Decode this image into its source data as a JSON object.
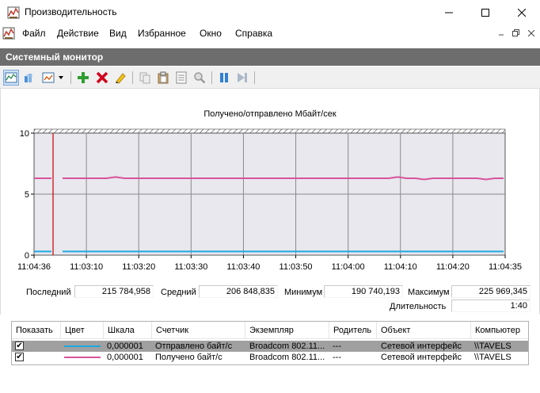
{
  "window": {
    "title": "Производительность",
    "controls": [
      "minimize-icon",
      "maximize-icon",
      "close-icon"
    ]
  },
  "menu": {
    "items": [
      "Файл",
      "Действие",
      "Вид",
      "Избранное",
      "Окно",
      "Справка"
    ]
  },
  "panel": {
    "title": "Системный монитор"
  },
  "toolbar": {
    "icons": [
      "view-graph-icon",
      "view-histogram-icon",
      "view-report-icon",
      "dropdown-arrow-icon",
      "add-counter-icon",
      "delete-counter-icon",
      "highlight-icon",
      "copy-icon",
      "paste-icon",
      "properties-icon",
      "zoom-icon",
      "pause-icon",
      "next-icon"
    ]
  },
  "chart_data": {
    "type": "line",
    "title": "Получено/отправлено Мбайт/сек",
    "ylim": [
      0,
      10
    ],
    "yticks": [
      "10",
      "5",
      "0"
    ],
    "xticks": [
      "11:04:36",
      "11:03:10",
      "11:03:20",
      "11:03:30",
      "11:03:40",
      "11:03:50",
      "11:04:00",
      "11:04:10",
      "11:04:20",
      "11:04:35"
    ],
    "current_time_marker": "11:04:36",
    "colors": {
      "received": "#d9539b",
      "sent": "#1fa7e1",
      "marker": "#cc0000",
      "plot_bg": "#e8e8ee",
      "grid": "#8a8a8a"
    },
    "series": [
      {
        "values": [
          6.3,
          6.3,
          6.3,
          6.3,
          6.3,
          6.3,
          6.4,
          6.3,
          6.3,
          6.3,
          6.3,
          6.3,
          6.3,
          6.3,
          6.3,
          6.3,
          6.3,
          6.3,
          6.3,
          6.3,
          6.3,
          6.3,
          6.3,
          6.3,
          6.3,
          6.3,
          6.3,
          6.3,
          6.3,
          6.3,
          6.3,
          6.3,
          6.3,
          6.3,
          6.3,
          6.3,
          6.3,
          6.3,
          6.4,
          6.3,
          6.3,
          6.2,
          6.3,
          6.3,
          6.3,
          6.3,
          6.3,
          6.3,
          6.2,
          6.3,
          6.3
        ],
        "color": "#d9539b"
      },
      {
        "values": [
          0.3,
          0.3,
          0.3,
          0.3,
          0.3,
          0.3,
          0.3,
          0.3,
          0.3,
          0.3,
          0.3,
          0.3,
          0.3,
          0.3,
          0.3,
          0.3,
          0.3,
          0.3,
          0.3,
          0.3,
          0.3,
          0.3,
          0.3,
          0.3,
          0.3,
          0.3,
          0.3,
          0.3,
          0.3,
          0.3,
          0.3,
          0.3,
          0.3,
          0.3,
          0.3,
          0.3,
          0.3,
          0.3,
          0.3,
          0.3,
          0.3,
          0.3,
          0.3,
          0.3,
          0.3,
          0.3,
          0.3,
          0.3,
          0.3,
          0.3,
          0.3
        ],
        "color": "#1fa7e1"
      }
    ]
  },
  "stats": {
    "last_label": "Последний",
    "last_value": "215 784,958",
    "avg_label": "Средний",
    "avg_value": "206 848,835",
    "min_label": "Минимум",
    "min_value": "190 740,193",
    "max_label": "Максимум",
    "max_value": "225 969,345",
    "duration_label": "Длительность",
    "duration_value": "1:40"
  },
  "counters": {
    "columns": [
      "Показать",
      "Цвет",
      "Шкала",
      "Счетчик",
      "Экземпляр",
      "Родитель",
      "Объект",
      "Компьютер"
    ],
    "rows": [
      {
        "show": "✔",
        "color": "#1fa7e1",
        "scale": "0,000001",
        "counter": "Отправлено байт/с",
        "instance": "Broadcom 802.11...",
        "parent": "---",
        "object": "Сетевой интерфейс",
        "computer": "\\\\TAVELS"
      },
      {
        "show": "✔",
        "color": "#d9539b",
        "scale": "0,000001",
        "counter": "Получено байт/с",
        "instance": "Broadcom 802.11...",
        "parent": "---",
        "object": "Сетевой интерфейс",
        "computer": "\\\\TAVELS"
      }
    ]
  }
}
